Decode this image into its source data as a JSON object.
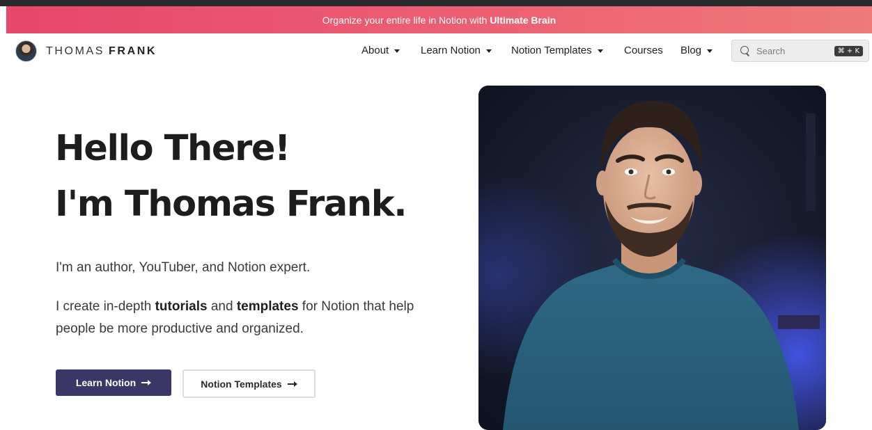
{
  "promo": {
    "text": "Organize your entire life in Notion with",
    "highlight": "Ultimate Brain"
  },
  "brand": {
    "first": "THOMAS",
    "last": "FRANK"
  },
  "nav": {
    "items": [
      {
        "label": "About",
        "has_dropdown": true
      },
      {
        "label": "Learn Notion",
        "has_dropdown": true
      },
      {
        "label": "Notion Templates",
        "has_dropdown": true
      },
      {
        "label": "Courses",
        "has_dropdown": false
      },
      {
        "label": "Blog",
        "has_dropdown": true
      }
    ]
  },
  "search": {
    "placeholder": "Search",
    "shortcut": "⌘ + K"
  },
  "hero": {
    "title_line1": "Hello There!",
    "title_line2": "I'm Thomas Frank.",
    "intro": "I'm an author, YouTuber, and Notion expert.",
    "desc_pre": "I create in-depth",
    "desc_bold1": "tutorials",
    "desc_mid": "and",
    "desc_bold2": "templates",
    "desc_post": "for Notion that help people be more productive and organized.",
    "primary_button": "Learn Notion",
    "secondary_button": "Notion Templates"
  },
  "colors": {
    "banner": "#e7476a",
    "primary_button": "#3a3766"
  }
}
